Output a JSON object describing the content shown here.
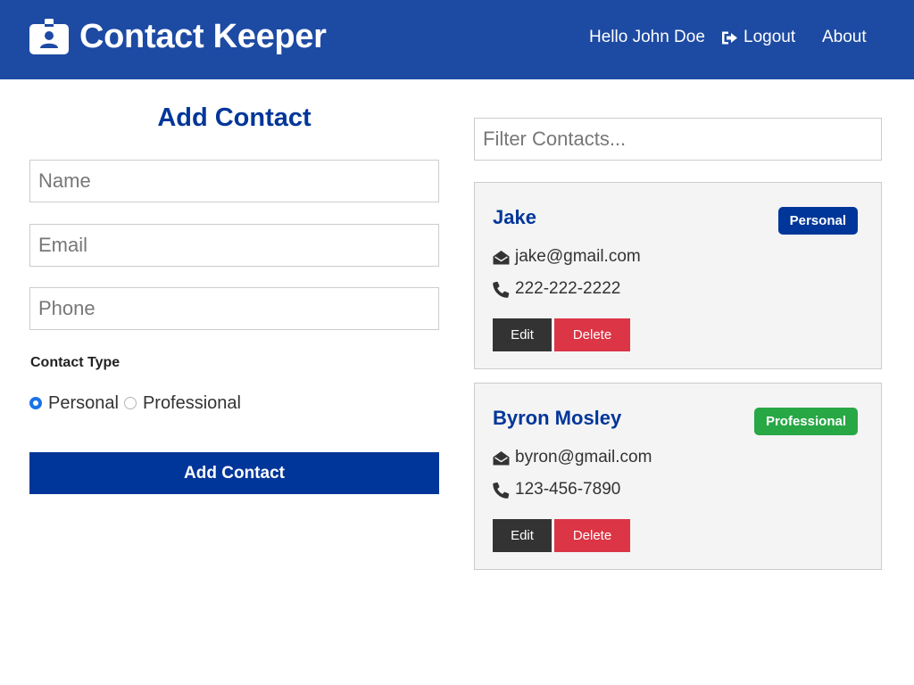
{
  "navbar": {
    "brand": "Contact Keeper",
    "greeting": "Hello John Doe",
    "logout": "Logout",
    "about": "About"
  },
  "form": {
    "title": "Add Contact",
    "name_placeholder": "Name",
    "email_placeholder": "Email",
    "phone_placeholder": "Phone",
    "type_label": "Contact Type",
    "options": [
      "Personal",
      "Professional"
    ],
    "selected": "Personal",
    "submit": "Add Contact"
  },
  "filter": {
    "placeholder": "Filter Contacts..."
  },
  "contacts": [
    {
      "name": "Jake",
      "type": "Personal",
      "email": "jake@gmail.com",
      "phone": "222-222-2222",
      "edit": "Edit",
      "delete": "Delete"
    },
    {
      "name": "Byron Mosley",
      "type": "Professional",
      "email": "byron@gmail.com",
      "phone": "123-456-7890",
      "edit": "Edit",
      "delete": "Delete"
    }
  ],
  "colors": {
    "navbar": "#1d4aa3",
    "primary": "#003699",
    "personal_badge": "#003699",
    "professional_badge": "#28a745",
    "edit_button": "#333333",
    "delete_button": "#dc3545",
    "card_background": "#f4f4f4"
  },
  "icons": {
    "brand": "id-badge-icon",
    "logout": "sign-out-icon",
    "email": "envelope-open-icon",
    "phone": "phone-icon"
  }
}
